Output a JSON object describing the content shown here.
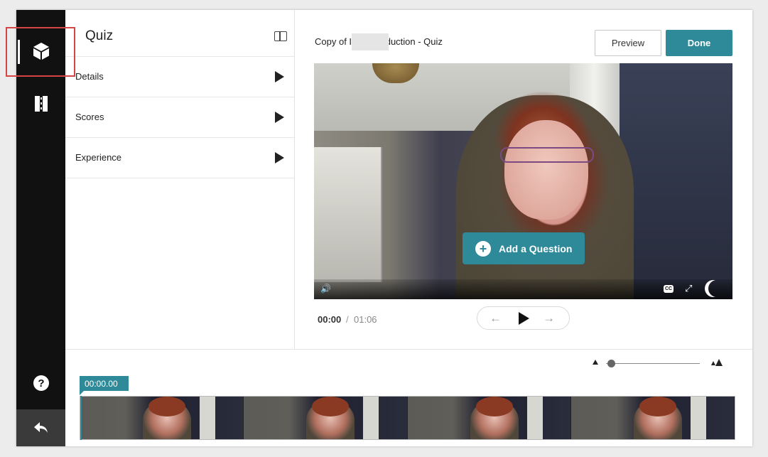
{
  "rail": {
    "quiz_icon": "cube-icon",
    "chapters_icon": "chapters-icon",
    "help_icon": "help-icon",
    "back_icon": "back-arrow-icon"
  },
  "panel": {
    "title": "Quiz",
    "items": [
      {
        "label": "Details"
      },
      {
        "label": "Scores"
      },
      {
        "label": "Experience"
      }
    ]
  },
  "header": {
    "video_title": "Copy of I       ntroduction - Quiz",
    "preview_label": "Preview",
    "done_label": "Done"
  },
  "video": {
    "add_question_label": "Add a Question",
    "cc_label": "CC"
  },
  "playback": {
    "current_time": "00:00",
    "separator": "/",
    "total_time": "01:06"
  },
  "timeline": {
    "timecode": "00:00.00",
    "frame_count": 4
  },
  "colors": {
    "accent": "#2e8a99",
    "rail_bg": "#111111",
    "highlight": "#d64545"
  }
}
